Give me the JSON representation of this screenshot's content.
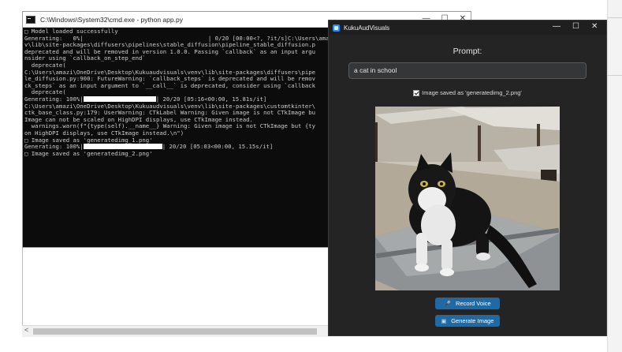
{
  "cmd_window": {
    "title": "C:\\Windows\\System32\\cmd.exe - python  app.py",
    "controls": [
      "—",
      "☐",
      "✕"
    ],
    "lines": [
      "□ Model loaded successfully",
      "Generating:   0%|                                    | 0/20 [00:00<?, ?it/s]C:\\Users\\amazi",
      "v\\lib\\site-packages\\diffusers\\pipelines\\stable_diffusion\\pipeline_stable_diffusion.p",
      "deprecated and will be removed in version 1.0.0. Passing `callback` as an input argu",
      "nsider using `callback_on_step_end`",
      "  deprecate(",
      "C:\\Users\\amazi\\OneDrive\\Desktop\\Kukuaudvisuals\\venv\\lib\\site-packages\\diffusers\\pipe",
      "le_diffusion.py:900: FutureWarning: `callback_steps` is deprecated and will be remov",
      "ck_steps` as an input argument to `__call__` is deprecated, consider using `callback",
      "  deprecate("
    ],
    "progress_line_1": {
      "prefix": "Generating: 100%|",
      "suffix": "| 20/20 [05:16<00:00, 15.81s/it]"
    },
    "lines_2": [
      "C:\\Users\\amazi\\OneDrive\\Desktop\\Kukuaudvisuals\\venv\\lib\\site-packages\\customtkinter\\",
      "ctk_base_class.py:179: UserWarning: CTkLabel Warning: Given image is not CTkImage bu",
      "Image can not be scaled on HighDPI displays, use CTkImage instead.",
      "",
      "  warnings.warn(f\"{type(self).__name__} Warning: Given image is not CTkImage but {ty",
      "on HighDPI displays, use CTkImage instead.\\n\")",
      "□ Image saved as 'generatedimg_1.png'"
    ],
    "progress_line_2": {
      "prefix": "Generating: 100%|",
      "suffix": "| 20/20 [05:03<00:00, 15.15s/it]"
    },
    "lines_3": [
      "□ Image saved as 'generatedimg_2.png'"
    ]
  },
  "app_window": {
    "title": "KukuAudVisuals",
    "controls": [
      "—",
      "☐",
      "✕"
    ],
    "prompt_label": "Prompt:",
    "prompt_value": "a cat in school",
    "saved_checkbox_checked": true,
    "saved_text": "Image saved as 'generatedimg_2.png'",
    "record_button": "Record Voice",
    "generate_button": "Generate Image",
    "record_icon": "microphone-icon",
    "generate_icon": "image-icon",
    "accent_color": "#1f6aa5"
  },
  "background_scrollbar": {
    "left_arrow": "<"
  }
}
